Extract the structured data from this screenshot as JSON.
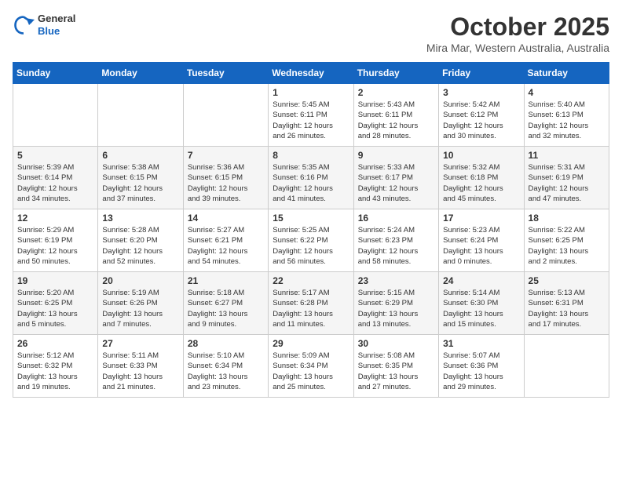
{
  "logo": {
    "general": "General",
    "blue": "Blue"
  },
  "header": {
    "title": "October 2025",
    "subtitle": "Mira Mar, Western Australia, Australia"
  },
  "weekdays": [
    "Sunday",
    "Monday",
    "Tuesday",
    "Wednesday",
    "Thursday",
    "Friday",
    "Saturday"
  ],
  "weeks": [
    [
      {
        "day": "",
        "info": ""
      },
      {
        "day": "",
        "info": ""
      },
      {
        "day": "",
        "info": ""
      },
      {
        "day": "1",
        "info": "Sunrise: 5:45 AM\nSunset: 6:11 PM\nDaylight: 12 hours\nand 26 minutes."
      },
      {
        "day": "2",
        "info": "Sunrise: 5:43 AM\nSunset: 6:11 PM\nDaylight: 12 hours\nand 28 minutes."
      },
      {
        "day": "3",
        "info": "Sunrise: 5:42 AM\nSunset: 6:12 PM\nDaylight: 12 hours\nand 30 minutes."
      },
      {
        "day": "4",
        "info": "Sunrise: 5:40 AM\nSunset: 6:13 PM\nDaylight: 12 hours\nand 32 minutes."
      }
    ],
    [
      {
        "day": "5",
        "info": "Sunrise: 5:39 AM\nSunset: 6:14 PM\nDaylight: 12 hours\nand 34 minutes."
      },
      {
        "day": "6",
        "info": "Sunrise: 5:38 AM\nSunset: 6:15 PM\nDaylight: 12 hours\nand 37 minutes."
      },
      {
        "day": "7",
        "info": "Sunrise: 5:36 AM\nSunset: 6:15 PM\nDaylight: 12 hours\nand 39 minutes."
      },
      {
        "day": "8",
        "info": "Sunrise: 5:35 AM\nSunset: 6:16 PM\nDaylight: 12 hours\nand 41 minutes."
      },
      {
        "day": "9",
        "info": "Sunrise: 5:33 AM\nSunset: 6:17 PM\nDaylight: 12 hours\nand 43 minutes."
      },
      {
        "day": "10",
        "info": "Sunrise: 5:32 AM\nSunset: 6:18 PM\nDaylight: 12 hours\nand 45 minutes."
      },
      {
        "day": "11",
        "info": "Sunrise: 5:31 AM\nSunset: 6:19 PM\nDaylight: 12 hours\nand 47 minutes."
      }
    ],
    [
      {
        "day": "12",
        "info": "Sunrise: 5:29 AM\nSunset: 6:19 PM\nDaylight: 12 hours\nand 50 minutes."
      },
      {
        "day": "13",
        "info": "Sunrise: 5:28 AM\nSunset: 6:20 PM\nDaylight: 12 hours\nand 52 minutes."
      },
      {
        "day": "14",
        "info": "Sunrise: 5:27 AM\nSunset: 6:21 PM\nDaylight: 12 hours\nand 54 minutes."
      },
      {
        "day": "15",
        "info": "Sunrise: 5:25 AM\nSunset: 6:22 PM\nDaylight: 12 hours\nand 56 minutes."
      },
      {
        "day": "16",
        "info": "Sunrise: 5:24 AM\nSunset: 6:23 PM\nDaylight: 12 hours\nand 58 minutes."
      },
      {
        "day": "17",
        "info": "Sunrise: 5:23 AM\nSunset: 6:24 PM\nDaylight: 13 hours\nand 0 minutes."
      },
      {
        "day": "18",
        "info": "Sunrise: 5:22 AM\nSunset: 6:25 PM\nDaylight: 13 hours\nand 2 minutes."
      }
    ],
    [
      {
        "day": "19",
        "info": "Sunrise: 5:20 AM\nSunset: 6:25 PM\nDaylight: 13 hours\nand 5 minutes."
      },
      {
        "day": "20",
        "info": "Sunrise: 5:19 AM\nSunset: 6:26 PM\nDaylight: 13 hours\nand 7 minutes."
      },
      {
        "day": "21",
        "info": "Sunrise: 5:18 AM\nSunset: 6:27 PM\nDaylight: 13 hours\nand 9 minutes."
      },
      {
        "day": "22",
        "info": "Sunrise: 5:17 AM\nSunset: 6:28 PM\nDaylight: 13 hours\nand 11 minutes."
      },
      {
        "day": "23",
        "info": "Sunrise: 5:15 AM\nSunset: 6:29 PM\nDaylight: 13 hours\nand 13 minutes."
      },
      {
        "day": "24",
        "info": "Sunrise: 5:14 AM\nSunset: 6:30 PM\nDaylight: 13 hours\nand 15 minutes."
      },
      {
        "day": "25",
        "info": "Sunrise: 5:13 AM\nSunset: 6:31 PM\nDaylight: 13 hours\nand 17 minutes."
      }
    ],
    [
      {
        "day": "26",
        "info": "Sunrise: 5:12 AM\nSunset: 6:32 PM\nDaylight: 13 hours\nand 19 minutes."
      },
      {
        "day": "27",
        "info": "Sunrise: 5:11 AM\nSunset: 6:33 PM\nDaylight: 13 hours\nand 21 minutes."
      },
      {
        "day": "28",
        "info": "Sunrise: 5:10 AM\nSunset: 6:34 PM\nDaylight: 13 hours\nand 23 minutes."
      },
      {
        "day": "29",
        "info": "Sunrise: 5:09 AM\nSunset: 6:34 PM\nDaylight: 13 hours\nand 25 minutes."
      },
      {
        "day": "30",
        "info": "Sunrise: 5:08 AM\nSunset: 6:35 PM\nDaylight: 13 hours\nand 27 minutes."
      },
      {
        "day": "31",
        "info": "Sunrise: 5:07 AM\nSunset: 6:36 PM\nDaylight: 13 hours\nand 29 minutes."
      },
      {
        "day": "",
        "info": ""
      }
    ]
  ]
}
